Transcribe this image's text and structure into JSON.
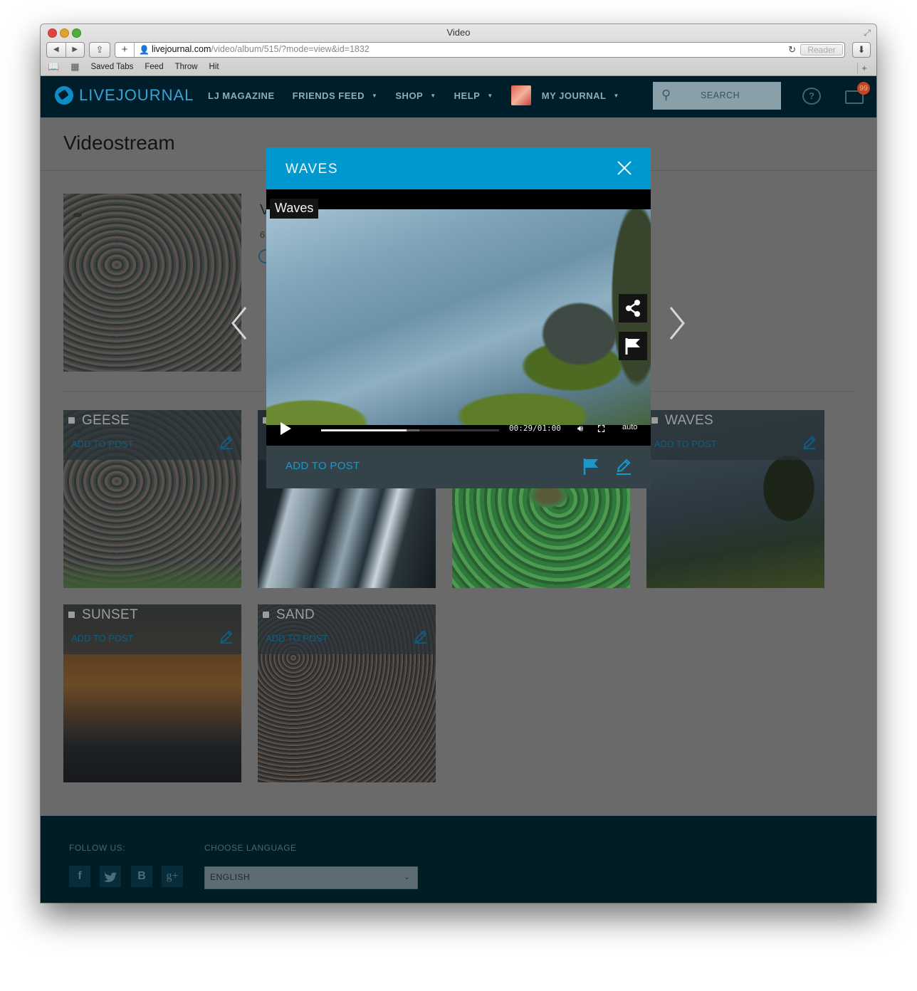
{
  "browser": {
    "window_title": "Video",
    "url_host": "livejournal.com",
    "url_path": "/video/album/515/?mode=view&id=1832",
    "reader_label": "Reader",
    "bookmarks": [
      "Saved Tabs",
      "Feed",
      "Throw",
      "Hit"
    ]
  },
  "header": {
    "logo_text": "LIVEJOURNAL",
    "nav": [
      {
        "label": "LJ MAGAZINE",
        "dropdown": false
      },
      {
        "label": "FRIENDS FEED",
        "dropdown": true
      },
      {
        "label": "SHOP",
        "dropdown": true
      },
      {
        "label": "HELP",
        "dropdown": true
      },
      {
        "label": "MY JOURNAL",
        "dropdown": true
      }
    ],
    "search_placeholder": "SEARCH",
    "mail_badge": "99",
    "brand_color": "#0099cf"
  },
  "page": {
    "title": "Videostream",
    "partial_text_1": "V",
    "partial_text_2": "6"
  },
  "tiles": [
    {
      "title": "GEESE",
      "action": "ADD TO POST",
      "thumb": "geese"
    },
    {
      "title": "",
      "action": "",
      "thumb": "water"
    },
    {
      "title": "",
      "action": "",
      "thumb": "green"
    },
    {
      "title": "WAVES",
      "action": "ADD TO POST",
      "thumb": "waves"
    },
    {
      "title": "SUNSET",
      "action": "ADD TO POST",
      "thumb": "sunset"
    },
    {
      "title": "SAND",
      "action": "ADD TO POST",
      "thumb": "sand"
    }
  ],
  "modal": {
    "title": "WAVES",
    "video_label": "Waves",
    "time": "00:29/01:00",
    "quality": "auto",
    "progress": 0.48,
    "buffered": 0.55,
    "add_to_post": "ADD TO POST"
  },
  "footer": {
    "follow_label": "FOLLOW US:",
    "language_label": "CHOOSE LANGUAGE",
    "language_value": "ENGLISH",
    "social": [
      "f",
      "twitter-icon",
      "B",
      "g+"
    ]
  }
}
